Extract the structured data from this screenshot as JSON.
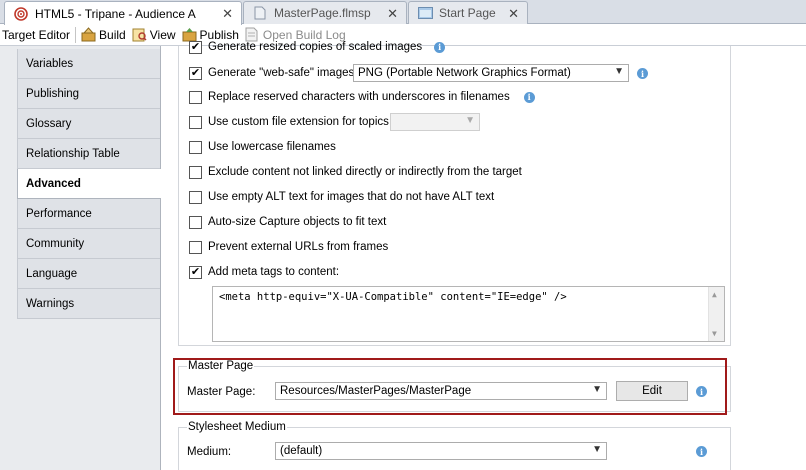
{
  "tabs": [
    {
      "label": "HTML5 - Tripane - Audience A",
      "active": true
    },
    {
      "label": "MasterPage.flmsp",
      "active": false
    },
    {
      "label": "Start Page",
      "active": false
    }
  ],
  "toolbar": {
    "target_editor": "Target Editor",
    "build": "Build",
    "view": "View",
    "publish": "Publish",
    "open_build_log": "Open Build Log"
  },
  "nav": {
    "items": [
      {
        "label": "Variables"
      },
      {
        "label": "Publishing"
      },
      {
        "label": "Glossary"
      },
      {
        "label": "Relationship Table"
      },
      {
        "label": "Advanced",
        "active": true
      },
      {
        "label": "Performance"
      },
      {
        "label": "Community"
      },
      {
        "label": "Language"
      },
      {
        "label": "Warnings"
      }
    ]
  },
  "options": {
    "generate_resized": "Generate resized copies of scaled images",
    "web_safe": "Generate \"web-safe\" images",
    "web_safe_format": "PNG (Portable Network Graphics Format)",
    "replace_reserved": "Replace reserved characters with underscores in filenames",
    "custom_ext": "Use custom file extension for topics",
    "custom_ext_value": "",
    "lowercase": "Use lowercase filenames",
    "exclude_unlinked": "Exclude content not linked directly or indirectly from the target",
    "empty_alt": "Use empty ALT text for images that do not have ALT text",
    "autosize_capture": "Auto-size Capture objects to fit text",
    "prevent_frames": "Prevent external URLs from frames",
    "meta_tags": "Add meta tags to content:",
    "meta_tags_value": "<meta http-equiv=\"X-UA-Compatible\" content=\"IE=edge\" />"
  },
  "master_page": {
    "group_title": "Master Page",
    "label": "Master Page:",
    "value": "Resources/MasterPages/MasterPage",
    "edit_button": "Edit"
  },
  "stylesheet": {
    "group_title": "Stylesheet Medium",
    "label": "Medium:",
    "value": "(default)"
  },
  "colors": {
    "accent_info": "#5b9bd5",
    "highlight_border": "#a01a1a"
  }
}
